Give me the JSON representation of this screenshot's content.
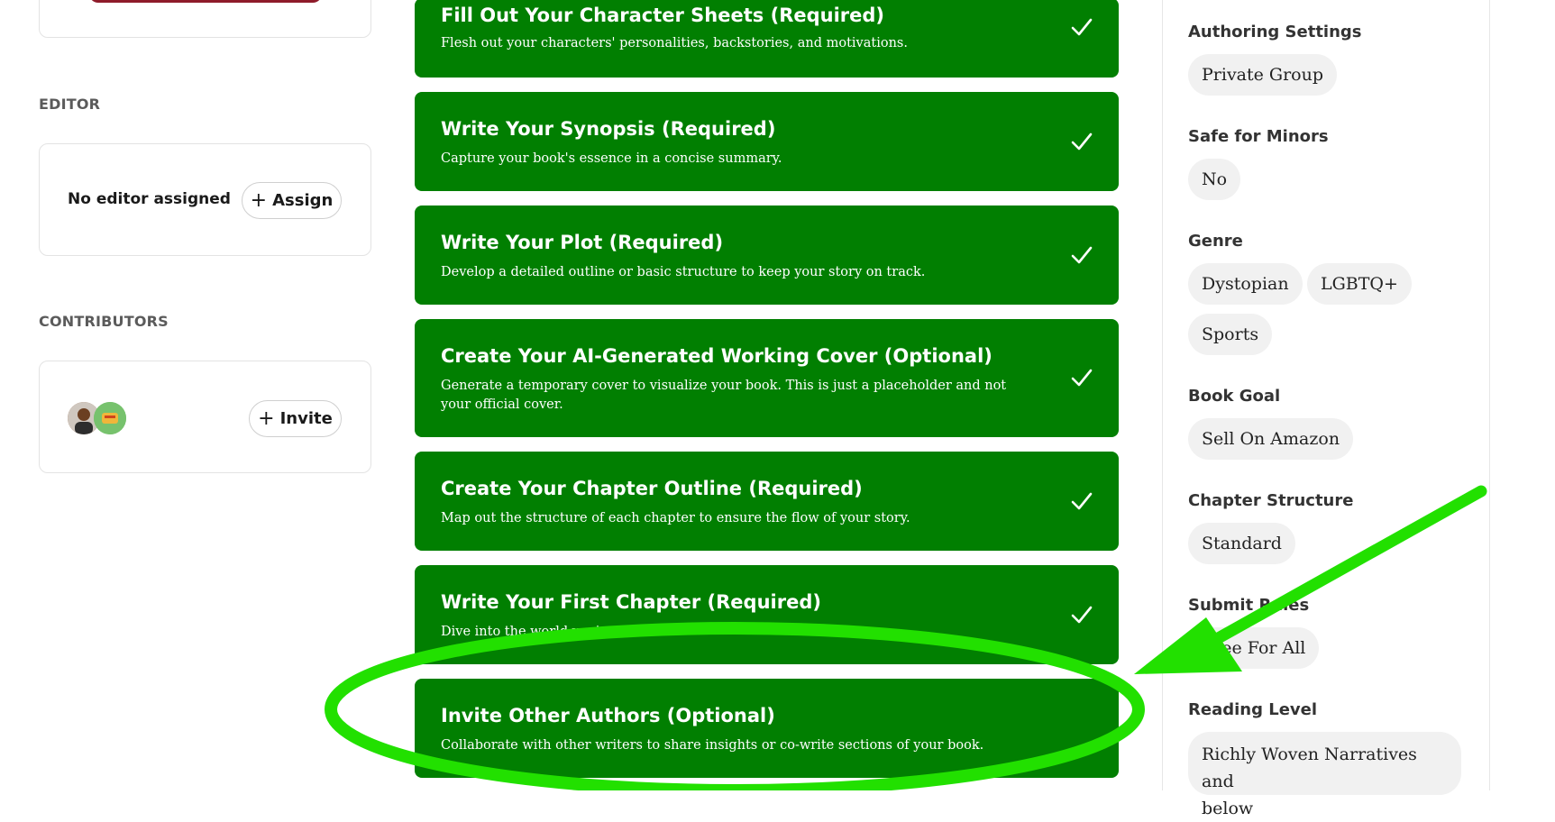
{
  "sidebar": {
    "editor_label": "EDITOR",
    "editor_status": "No editor assigned",
    "assign_label": "Assign",
    "contributors_label": "CONTRIBUTORS",
    "invite_label": "Invite"
  },
  "tasks": [
    {
      "title": "Fill Out Your Character Sheets (Required)",
      "desc": "Flesh out your characters' personalities, backstories, and motivations."
    },
    {
      "title": "Write Your Synopsis (Required)",
      "desc": "Capture your book's essence in a concise summary."
    },
    {
      "title": "Write Your Plot (Required)",
      "desc": "Develop a detailed outline or basic structure to keep your story on track."
    },
    {
      "title": "Create Your AI-Generated Working Cover (Optional)",
      "desc": "Generate a temporary cover to visualize your book. This is just a placeholder and not your official cover."
    },
    {
      "title": "Create Your Chapter Outline (Required)",
      "desc": "Map out the structure of each chapter to ensure the flow of your story."
    },
    {
      "title": "Write Your First Chapter (Required)",
      "desc": "Dive into the world you've created"
    },
    {
      "title": "Invite Other Authors (Optional)",
      "desc": "Collaborate with other writers to share insights or co-write sections of your book."
    }
  ],
  "settings": {
    "authoring_label": "Authoring Settings",
    "authoring_value": "Private Group",
    "minors_label": "Safe for Minors",
    "minors_value": "No",
    "genre_label": "Genre",
    "genres": [
      "Dystopian",
      "LGBTQ+",
      "Sports"
    ],
    "goal_label": "Book Goal",
    "goal_value": "Sell On Amazon",
    "structure_label": "Chapter Structure",
    "structure_value": "Standard",
    "submit_label": "Submit Rules",
    "submit_value": "Free For All",
    "reading_label": "Reading Level",
    "reading_value_1": "Richly Woven Narratives and",
    "reading_value_2": "below"
  },
  "annotation_color": "#22e000",
  "task_color": "#017f01"
}
